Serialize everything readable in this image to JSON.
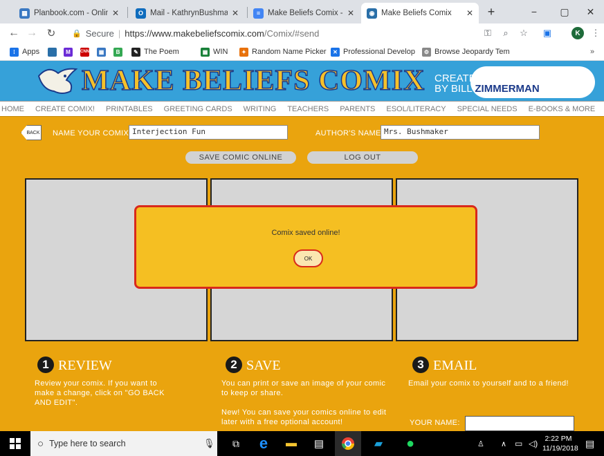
{
  "browser": {
    "tabs": [
      {
        "title": "Planbook.com - Online Le",
        "icon": "planbook-icon",
        "color": "#3a78c2"
      },
      {
        "title": "Mail - KathrynBushmaker",
        "icon": "outlook-icon",
        "color": "#0f6cbd"
      },
      {
        "title": "Make Beliefs Comix - Goo",
        "icon": "docs-icon",
        "color": "#4285f4"
      },
      {
        "title": "Make Beliefs Comix",
        "icon": "makebeliefs-icon",
        "color": "#2a6fa8"
      }
    ],
    "new_tab": "+",
    "window": {
      "minimize": "−",
      "maximize": "▢",
      "close": "✕"
    },
    "address": {
      "secure_label": "Secure",
      "host": "https://www.makebeliefscomix.com",
      "path": "/Comix/#send"
    },
    "profile_initial": "K",
    "bookmarks": [
      {
        "label": "Apps",
        "color": "#1a73e8"
      },
      {
        "label": "",
        "color": "#2a6fa8"
      },
      {
        "label": "",
        "color": "#6b2bd6"
      },
      {
        "label": "",
        "color": "#cc0000"
      },
      {
        "label": "",
        "color": "#3a78c2"
      },
      {
        "label": "",
        "color": "#34a853"
      },
      {
        "label": "The Poem",
        "color": "#222222"
      },
      {
        "label": "WIN",
        "color": "#188038"
      },
      {
        "label": "Random Name Picker",
        "color": "#e8710a"
      },
      {
        "label": "Professional Develop",
        "color": "#1a73e8"
      },
      {
        "label": "Browse Jeopardy Tem",
        "color": "#888888"
      }
    ]
  },
  "site": {
    "logo": "MAKE BELIEFS COMIX",
    "created_line1": "CREATED",
    "created_line2": "BY BILL",
    "created_name": "ZIMMERMAN",
    "nav": [
      "HOME",
      "CREATE COMIX!",
      "PRINTABLES",
      "GREETING CARDS",
      "WRITING",
      "TEACHERS",
      "PARENTS",
      "ESOL/LITERACY",
      "SPECIAL NEEDS",
      "E-BOOKS & MORE"
    ],
    "back_label": "BACK",
    "name_label": "NAME YOUR COMIX",
    "name_value": "Interjection Fun",
    "author_label": "AUTHOR'S NAME",
    "author_value": "Mrs. Bushmaker",
    "save_online": "SAVE COMIC ONLINE",
    "logout": "LOG OUT",
    "steps": [
      {
        "num": "1",
        "title": "REVIEW",
        "text": "Review your comix. If you want to make a change, click on \"GO BACK AND EDIT\"."
      },
      {
        "num": "2",
        "title": "SAVE",
        "text": "You can print or save an image of your comic to keep or share.\n\nNew! You can save your comics online to edit later with a free optional account!"
      },
      {
        "num": "3",
        "title": "EMAIL",
        "text": "Email your comix to yourself and to a friend!"
      }
    ],
    "your_name_label": "YOUR NAME:"
  },
  "dialog": {
    "message": "Comix saved online!",
    "ok": "OK"
  },
  "taskbar": {
    "search_placeholder": "Type here to search",
    "time": "2:22 PM",
    "date": "11/19/2018"
  }
}
